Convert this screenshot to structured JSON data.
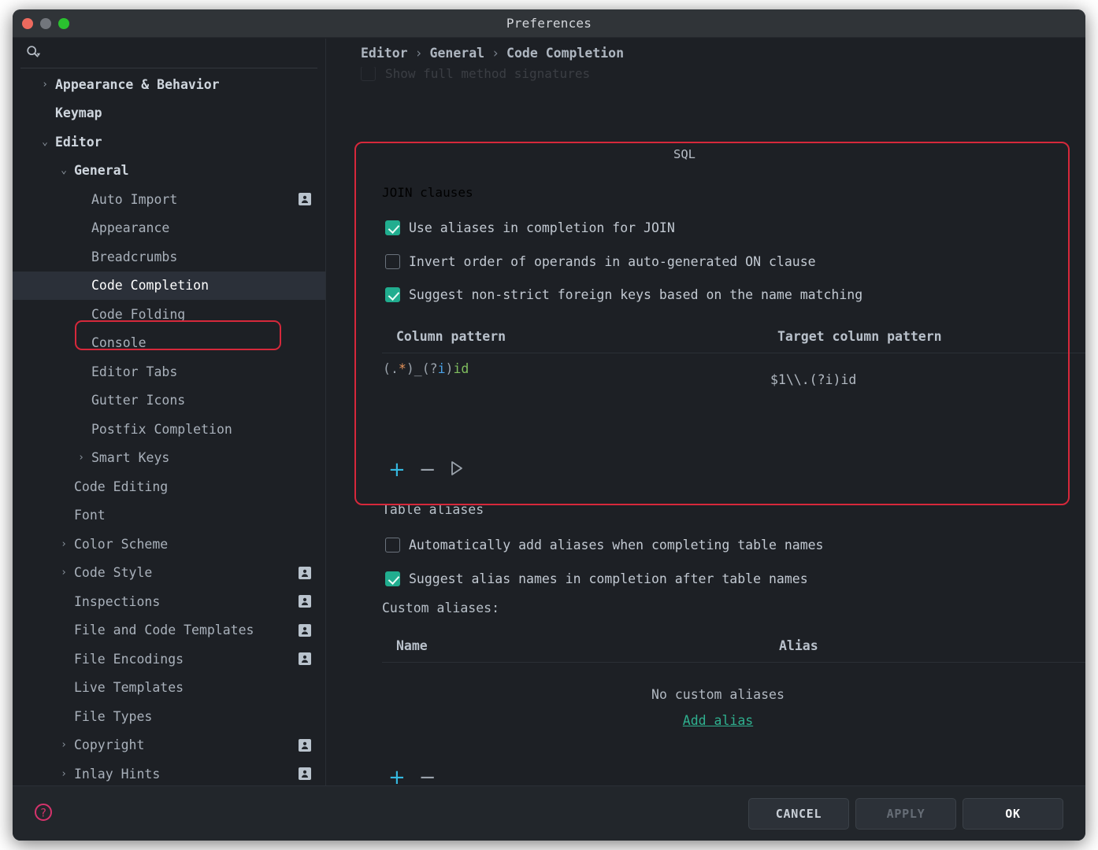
{
  "window": {
    "title": "Preferences",
    "traffic_lights": [
      "close-red",
      "minimize-gray",
      "zoom-green"
    ]
  },
  "sidebar": {
    "search": {
      "value": "",
      "placeholder": "",
      "icon": "search-icon"
    },
    "items": [
      {
        "label": "Appearance & Behavior",
        "depth": 0,
        "chevron": "›",
        "bold": true,
        "badge": false,
        "selected": false
      },
      {
        "label": "Keymap",
        "depth": 0,
        "chevron": "",
        "bold": true,
        "badge": false,
        "selected": false
      },
      {
        "label": "Editor",
        "depth": 0,
        "chevron": "⌄",
        "bold": true,
        "badge": false,
        "selected": false
      },
      {
        "label": "General",
        "depth": 1,
        "chevron": "⌄",
        "bold": true,
        "badge": false,
        "selected": false
      },
      {
        "label": "Auto Import",
        "depth": 2,
        "chevron": "",
        "bold": false,
        "badge": true,
        "selected": false
      },
      {
        "label": "Appearance",
        "depth": 2,
        "chevron": "",
        "bold": false,
        "badge": false,
        "selected": false
      },
      {
        "label": "Breadcrumbs",
        "depth": 2,
        "chevron": "",
        "bold": false,
        "badge": false,
        "selected": false
      },
      {
        "label": "Code Completion",
        "depth": 2,
        "chevron": "",
        "bold": false,
        "badge": false,
        "selected": true
      },
      {
        "label": "Code Folding",
        "depth": 2,
        "chevron": "",
        "bold": false,
        "badge": false,
        "selected": false
      },
      {
        "label": "Console",
        "depth": 2,
        "chevron": "",
        "bold": false,
        "badge": false,
        "selected": false
      },
      {
        "label": "Editor Tabs",
        "depth": 2,
        "chevron": "",
        "bold": false,
        "badge": false,
        "selected": false
      },
      {
        "label": "Gutter Icons",
        "depth": 2,
        "chevron": "",
        "bold": false,
        "badge": false,
        "selected": false
      },
      {
        "label": "Postfix Completion",
        "depth": 2,
        "chevron": "",
        "bold": false,
        "badge": false,
        "selected": false
      },
      {
        "label": "Smart Keys",
        "depth": 2,
        "chevron": "›",
        "bold": false,
        "badge": false,
        "selected": false
      },
      {
        "label": "Code Editing",
        "depth": 1,
        "chevron": "",
        "bold": false,
        "badge": false,
        "selected": false
      },
      {
        "label": "Font",
        "depth": 1,
        "chevron": "",
        "bold": false,
        "badge": false,
        "selected": false
      },
      {
        "label": "Color Scheme",
        "depth": 1,
        "chevron": "›",
        "bold": false,
        "badge": false,
        "selected": false
      },
      {
        "label": "Code Style",
        "depth": 1,
        "chevron": "›",
        "bold": false,
        "badge": true,
        "selected": false
      },
      {
        "label": "Inspections",
        "depth": 1,
        "chevron": "",
        "bold": false,
        "badge": true,
        "selected": false
      },
      {
        "label": "File and Code Templates",
        "depth": 1,
        "chevron": "",
        "bold": false,
        "badge": true,
        "selected": false
      },
      {
        "label": "File Encodings",
        "depth": 1,
        "chevron": "",
        "bold": false,
        "badge": true,
        "selected": false
      },
      {
        "label": "Live Templates",
        "depth": 1,
        "chevron": "",
        "bold": false,
        "badge": false,
        "selected": false
      },
      {
        "label": "File Types",
        "depth": 1,
        "chevron": "",
        "bold": false,
        "badge": false,
        "selected": false
      },
      {
        "label": "Copyright",
        "depth": 1,
        "chevron": "›",
        "bold": false,
        "badge": true,
        "selected": false
      },
      {
        "label": "Inlay Hints",
        "depth": 1,
        "chevron": "›",
        "bold": false,
        "badge": true,
        "selected": false
      }
    ]
  },
  "breadcrumb": {
    "parts": [
      "Editor",
      "General",
      "Code Completion"
    ],
    "separator": "›"
  },
  "main": {
    "clipped_option": {
      "label": "Show full method signatures",
      "checked": false
    },
    "sql_group": {
      "title": "SQL",
      "join_clauses": {
        "title": "JOIN clauses",
        "options": [
          {
            "label": "Use aliases in completion for JOIN",
            "checked": true
          },
          {
            "label": "Invert order of operands in auto-generated ON clause",
            "checked": false
          },
          {
            "label": "Suggest non-strict foreign keys based on the name matching",
            "checked": true
          }
        ],
        "table": {
          "headers": [
            "Column pattern",
            "Target column pattern"
          ],
          "rows": [
            {
              "column_pattern": "(.*)_(?i)id",
              "target_column_pattern": "$1\\\\.(?i)id"
            }
          ]
        },
        "toolbar": {
          "add": "+",
          "remove": "−",
          "run": "run-icon"
        }
      }
    },
    "table_aliases": {
      "title": "Table aliases",
      "options": [
        {
          "label": "Automatically add aliases when completing table names",
          "checked": false
        },
        {
          "label": "Suggest alias names in completion after table names",
          "checked": true
        }
      ],
      "custom_aliases_label": "Custom aliases:",
      "table": {
        "headers": [
          "Name",
          "Alias"
        ],
        "rows": [],
        "empty_message": "No custom aliases",
        "empty_action": "Add alias"
      },
      "toolbar": {
        "add": "+",
        "remove": "−"
      }
    }
  },
  "footer": {
    "help": "help-icon",
    "buttons": [
      {
        "label": "CANCEL",
        "state": "normal"
      },
      {
        "label": "APPLY",
        "state": "disabled"
      },
      {
        "label": "OK",
        "state": "primary"
      }
    ]
  },
  "colors": {
    "accent_checkbox": "#21ad8f",
    "accent_link": "#2fb08f",
    "accent_plus": "#35b9e0",
    "annotation": "#d6283b",
    "window_bg": "#1d2025",
    "titlebar_bg": "#303438",
    "footer_bg": "#22262b",
    "selection_bg": "#2b3039"
  }
}
